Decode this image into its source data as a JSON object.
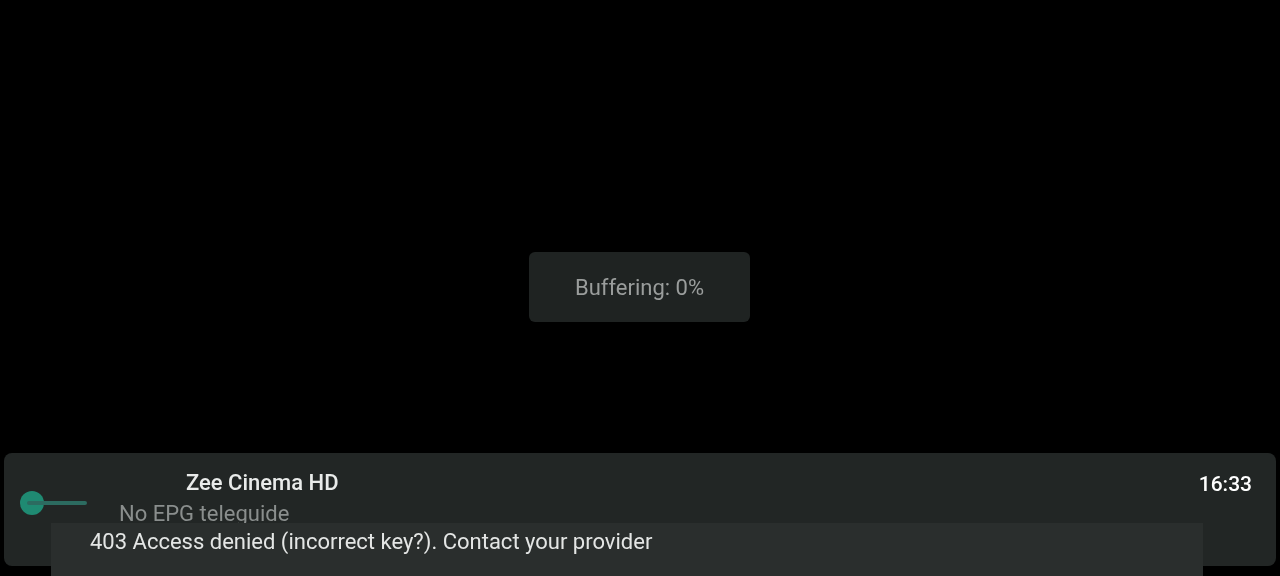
{
  "buffering": {
    "text": "Buffering: 0%"
  },
  "channel_bar": {
    "channel_name": "Zee Cinema HD",
    "epg": "No EPG teleguide",
    "clock": "16:33"
  },
  "toast": {
    "message": "403 Access denied (incorrect key?). Contact your provider"
  }
}
